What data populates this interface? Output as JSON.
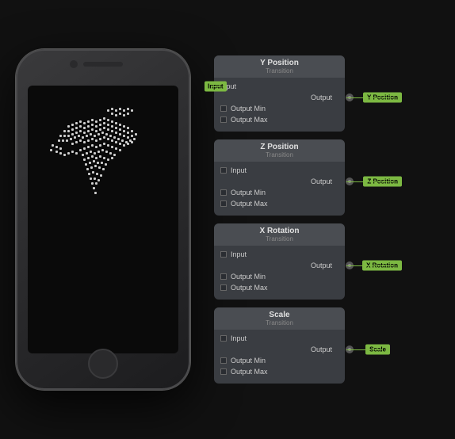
{
  "scene": {
    "background": "#111111"
  },
  "phone": {
    "screen_bg": "#0a0a0a"
  },
  "nodes": [
    {
      "id": "y-position",
      "title": "Y Position",
      "subtitle": "Transition",
      "input_label": "Input",
      "has_input": true,
      "rows": [
        {
          "label": "Input",
          "has_connector_left": true
        },
        {
          "label": "Output Min"
        },
        {
          "label": "Output Max"
        }
      ],
      "output_label": "Y Position",
      "output_text": "Output"
    },
    {
      "id": "z-position",
      "title": "Z Position",
      "subtitle": "Transition",
      "has_input": false,
      "rows": [
        {
          "label": "Input"
        },
        {
          "label": "Output Min"
        },
        {
          "label": "Output Max"
        }
      ],
      "output_label": "Z Position",
      "output_text": "Output"
    },
    {
      "id": "x-rotation",
      "title": "X Rotation",
      "subtitle": "Transition",
      "has_input": false,
      "rows": [
        {
          "label": "Input"
        },
        {
          "label": "Output Min"
        },
        {
          "label": "Output Max"
        }
      ],
      "output_label": "X Rotation",
      "output_text": "Output"
    },
    {
      "id": "scale",
      "title": "Scale",
      "subtitle": "Transition",
      "has_input": false,
      "rows": [
        {
          "label": "Input"
        },
        {
          "label": "Output Min"
        },
        {
          "label": "Output Max"
        }
      ],
      "output_label": "Scale",
      "output_text": "Output"
    }
  ]
}
